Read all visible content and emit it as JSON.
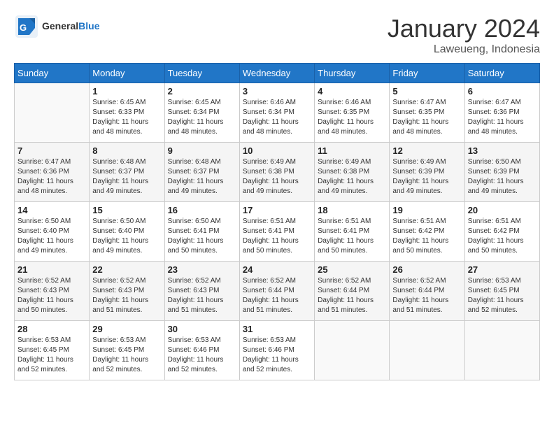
{
  "header": {
    "logo_general": "General",
    "logo_blue": "Blue",
    "month_title": "January 2024",
    "location": "Laweueng, Indonesia"
  },
  "weekdays": [
    "Sunday",
    "Monday",
    "Tuesday",
    "Wednesday",
    "Thursday",
    "Friday",
    "Saturday"
  ],
  "weeks": [
    [
      {
        "num": "",
        "info": ""
      },
      {
        "num": "1",
        "info": "Sunrise: 6:45 AM\nSunset: 6:33 PM\nDaylight: 11 hours\nand 48 minutes."
      },
      {
        "num": "2",
        "info": "Sunrise: 6:45 AM\nSunset: 6:34 PM\nDaylight: 11 hours\nand 48 minutes."
      },
      {
        "num": "3",
        "info": "Sunrise: 6:46 AM\nSunset: 6:34 PM\nDaylight: 11 hours\nand 48 minutes."
      },
      {
        "num": "4",
        "info": "Sunrise: 6:46 AM\nSunset: 6:35 PM\nDaylight: 11 hours\nand 48 minutes."
      },
      {
        "num": "5",
        "info": "Sunrise: 6:47 AM\nSunset: 6:35 PM\nDaylight: 11 hours\nand 48 minutes."
      },
      {
        "num": "6",
        "info": "Sunrise: 6:47 AM\nSunset: 6:36 PM\nDaylight: 11 hours\nand 48 minutes."
      }
    ],
    [
      {
        "num": "7",
        "info": "Sunrise: 6:47 AM\nSunset: 6:36 PM\nDaylight: 11 hours\nand 48 minutes."
      },
      {
        "num": "8",
        "info": "Sunrise: 6:48 AM\nSunset: 6:37 PM\nDaylight: 11 hours\nand 49 minutes."
      },
      {
        "num": "9",
        "info": "Sunrise: 6:48 AM\nSunset: 6:37 PM\nDaylight: 11 hours\nand 49 minutes."
      },
      {
        "num": "10",
        "info": "Sunrise: 6:49 AM\nSunset: 6:38 PM\nDaylight: 11 hours\nand 49 minutes."
      },
      {
        "num": "11",
        "info": "Sunrise: 6:49 AM\nSunset: 6:38 PM\nDaylight: 11 hours\nand 49 minutes."
      },
      {
        "num": "12",
        "info": "Sunrise: 6:49 AM\nSunset: 6:39 PM\nDaylight: 11 hours\nand 49 minutes."
      },
      {
        "num": "13",
        "info": "Sunrise: 6:50 AM\nSunset: 6:39 PM\nDaylight: 11 hours\nand 49 minutes."
      }
    ],
    [
      {
        "num": "14",
        "info": "Sunrise: 6:50 AM\nSunset: 6:40 PM\nDaylight: 11 hours\nand 49 minutes."
      },
      {
        "num": "15",
        "info": "Sunrise: 6:50 AM\nSunset: 6:40 PM\nDaylight: 11 hours\nand 49 minutes."
      },
      {
        "num": "16",
        "info": "Sunrise: 6:50 AM\nSunset: 6:41 PM\nDaylight: 11 hours\nand 50 minutes."
      },
      {
        "num": "17",
        "info": "Sunrise: 6:51 AM\nSunset: 6:41 PM\nDaylight: 11 hours\nand 50 minutes."
      },
      {
        "num": "18",
        "info": "Sunrise: 6:51 AM\nSunset: 6:41 PM\nDaylight: 11 hours\nand 50 minutes."
      },
      {
        "num": "19",
        "info": "Sunrise: 6:51 AM\nSunset: 6:42 PM\nDaylight: 11 hours\nand 50 minutes."
      },
      {
        "num": "20",
        "info": "Sunrise: 6:51 AM\nSunset: 6:42 PM\nDaylight: 11 hours\nand 50 minutes."
      }
    ],
    [
      {
        "num": "21",
        "info": "Sunrise: 6:52 AM\nSunset: 6:43 PM\nDaylight: 11 hours\nand 50 minutes."
      },
      {
        "num": "22",
        "info": "Sunrise: 6:52 AM\nSunset: 6:43 PM\nDaylight: 11 hours\nand 51 minutes."
      },
      {
        "num": "23",
        "info": "Sunrise: 6:52 AM\nSunset: 6:43 PM\nDaylight: 11 hours\nand 51 minutes."
      },
      {
        "num": "24",
        "info": "Sunrise: 6:52 AM\nSunset: 6:44 PM\nDaylight: 11 hours\nand 51 minutes."
      },
      {
        "num": "25",
        "info": "Sunrise: 6:52 AM\nSunset: 6:44 PM\nDaylight: 11 hours\nand 51 minutes."
      },
      {
        "num": "26",
        "info": "Sunrise: 6:52 AM\nSunset: 6:44 PM\nDaylight: 11 hours\nand 51 minutes."
      },
      {
        "num": "27",
        "info": "Sunrise: 6:53 AM\nSunset: 6:45 PM\nDaylight: 11 hours\nand 52 minutes."
      }
    ],
    [
      {
        "num": "28",
        "info": "Sunrise: 6:53 AM\nSunset: 6:45 PM\nDaylight: 11 hours\nand 52 minutes."
      },
      {
        "num": "29",
        "info": "Sunrise: 6:53 AM\nSunset: 6:45 PM\nDaylight: 11 hours\nand 52 minutes."
      },
      {
        "num": "30",
        "info": "Sunrise: 6:53 AM\nSunset: 6:46 PM\nDaylight: 11 hours\nand 52 minutes."
      },
      {
        "num": "31",
        "info": "Sunrise: 6:53 AM\nSunset: 6:46 PM\nDaylight: 11 hours\nand 52 minutes."
      },
      {
        "num": "",
        "info": ""
      },
      {
        "num": "",
        "info": ""
      },
      {
        "num": "",
        "info": ""
      }
    ]
  ]
}
